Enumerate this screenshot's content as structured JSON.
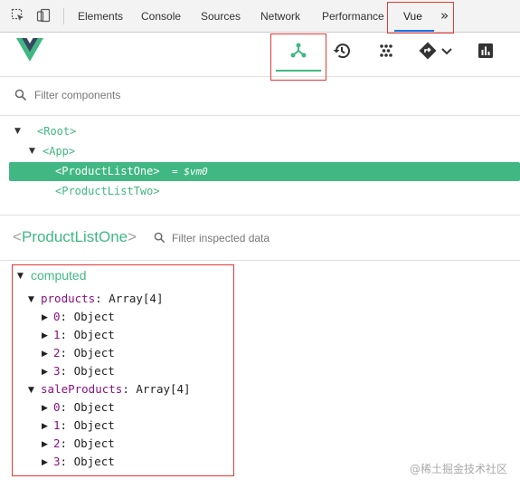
{
  "devtools_tabs": {
    "elements": "Elements",
    "console": "Console",
    "sources": "Sources",
    "network": "Network",
    "performance": "Performance",
    "vue": "Vue",
    "more": "»"
  },
  "toolbar": {
    "components_icon": "components-icon",
    "timeline_icon": "history-icon",
    "vuex_icon": "vuex-icon",
    "router_icon": "router-icon",
    "performance_icon": "bar-chart-icon"
  },
  "filter": {
    "placeholder": "Filter components"
  },
  "tree": {
    "root": "<Root>",
    "app": "<App>",
    "selected": "<ProductListOne>",
    "selected_var": "= $vm0",
    "sibling": "<ProductListTwo>"
  },
  "inspector": {
    "lt": "<",
    "name": "ProductListOne",
    "gt": ">",
    "filter_placeholder": "Filter inspected data",
    "section": "computed",
    "groups": [
      {
        "key": "products",
        "value": "Array[4]",
        "items": [
          {
            "key": "0",
            "value": "Object"
          },
          {
            "key": "1",
            "value": "Object"
          },
          {
            "key": "2",
            "value": "Object"
          },
          {
            "key": "3",
            "value": "Object"
          }
        ]
      },
      {
        "key": "saleProducts",
        "value": "Array[4]",
        "items": [
          {
            "key": "0",
            "value": "Object"
          },
          {
            "key": "1",
            "value": "Object"
          },
          {
            "key": "2",
            "value": "Object"
          },
          {
            "key": "3",
            "value": "Object"
          }
        ]
      }
    ]
  },
  "watermark": "@稀土掘金技术社区",
  "colors": {
    "vue_green": "#41b883",
    "accent_red": "#e53935",
    "tab_blue": "#1a73e8"
  }
}
